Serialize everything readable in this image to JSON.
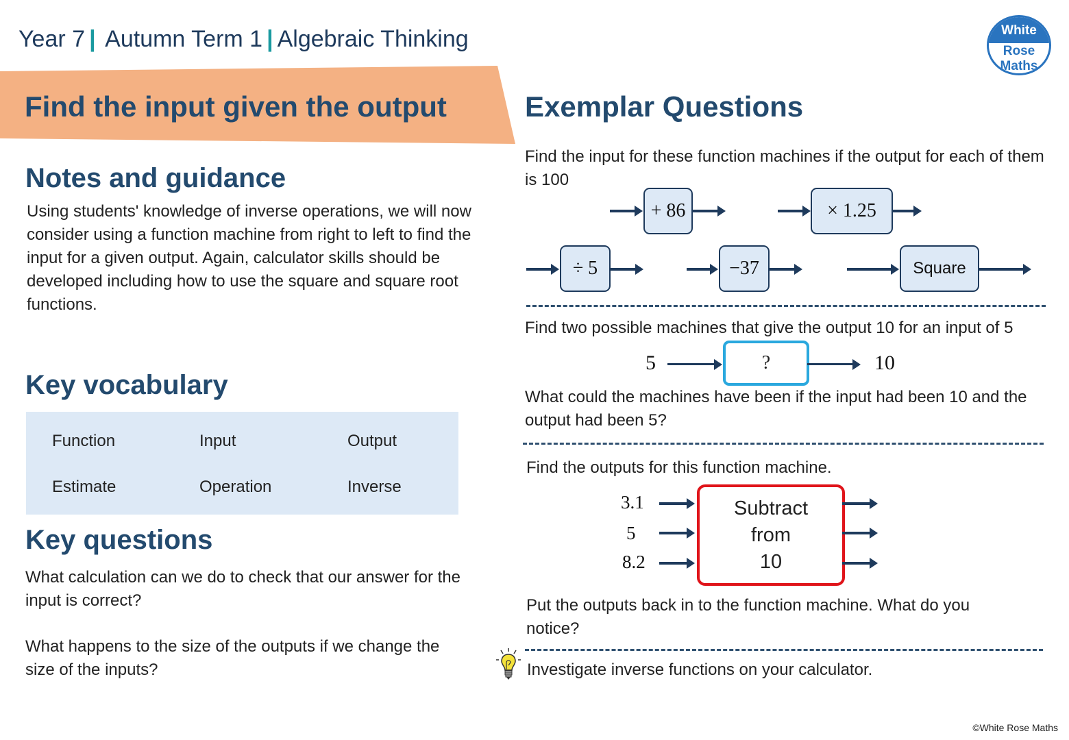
{
  "header": {
    "breadcrumb": [
      "Year 7",
      "Autumn Term 1",
      "Algebraic Thinking"
    ],
    "separator": "|",
    "logo": {
      "line1": "White",
      "line2": "Rose",
      "line3": "Maths"
    }
  },
  "banner": {
    "title": "Find the input given the output",
    "color": "#f4b183"
  },
  "notes": {
    "heading": "Notes and guidance",
    "text": "Using students' knowledge of inverse operations, we will now consider using a function machine from right to left to find the input for a given output.  Again, calculator skills should be developed including how to use the square and square root functions."
  },
  "vocabulary": {
    "heading": "Key vocabulary",
    "words": [
      "Function",
      "Input",
      "Output",
      "Estimate",
      "Operation",
      "Inverse"
    ]
  },
  "key_questions": {
    "heading": "Key questions",
    "items": [
      "What calculation can we do to check that our answer for the input is correct?",
      "What happens to the size of the outputs if we change the size of the inputs?"
    ]
  },
  "exemplar": {
    "heading": "Exemplar Questions",
    "q1": {
      "text": "Find the input for these function machines if the output for each of them is 100",
      "machines": [
        "+ 86",
        "× 1.25",
        "÷ 5",
        "−37",
        "Square"
      ]
    },
    "q2": {
      "text": "Find two possible machines that give the output 10 for an input of 5",
      "input": "5",
      "machine": "?",
      "output": "10",
      "followup": "What could the machines have been if the input had been 10 and the output had been 5?"
    },
    "q3": {
      "text": "Find the outputs for this function machine.",
      "inputs": [
        "3.1",
        "5",
        "8.2"
      ],
      "machine_lines": [
        "Subtract",
        "from",
        "10"
      ],
      "followup": "Put the outputs back in to the function machine.  What do you notice?"
    },
    "q4": {
      "text": "Investigate inverse functions on your calculator."
    }
  },
  "footer": {
    "copyright": "©White Rose Maths"
  },
  "colors": {
    "heading": "#234a6e",
    "accent_teal": "#1a9aa0",
    "vocab_bg": "#dde9f6",
    "question_box": "#2aa8de",
    "red_box": "#e0141a"
  }
}
